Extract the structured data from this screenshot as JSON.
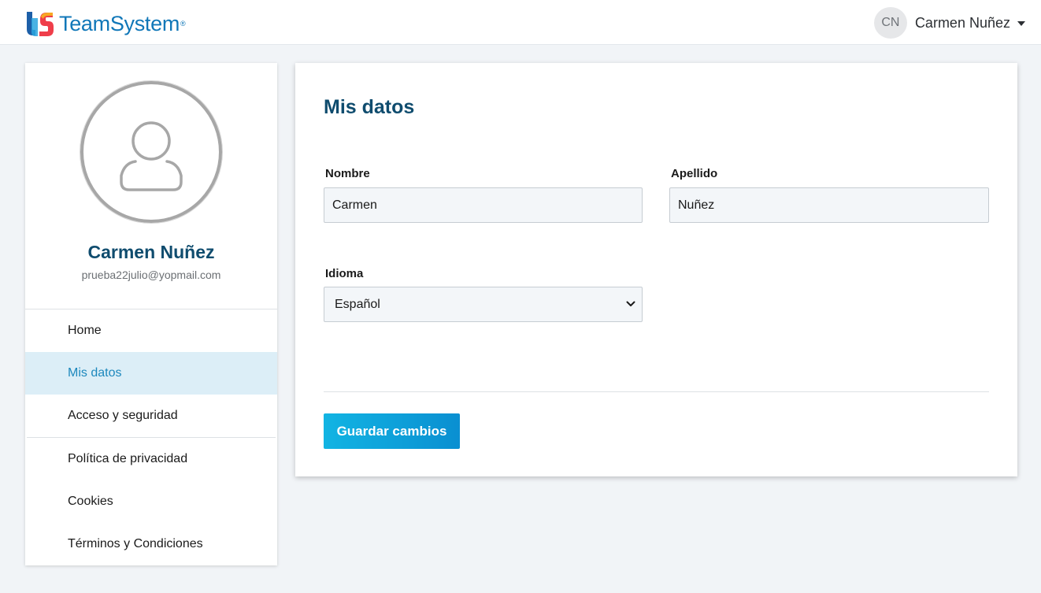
{
  "header": {
    "brand_name": "TeamSystem",
    "brand_mark": "®",
    "user_initials": "CN",
    "user_name": "Carmen Nuñez"
  },
  "profile": {
    "name": "Carmen Nuñez",
    "email": "prueba22julio@yopmail.com",
    "avatar_icon": "user-icon"
  },
  "sidebar": {
    "items": [
      {
        "label": "Home"
      },
      {
        "label": "Mis datos",
        "active": true
      },
      {
        "label": "Acceso y seguridad"
      },
      {
        "label": "Política de privacidad"
      },
      {
        "label": "Cookies"
      },
      {
        "label": "Términos y Condiciones"
      }
    ]
  },
  "form": {
    "title": "Mis datos",
    "nombre_label": "Nombre",
    "nombre_value": "Carmen",
    "apellido_label": "Apellido",
    "apellido_value": "Nuñez",
    "idioma_label": "Idioma",
    "idioma_value": "Español",
    "save_label": "Guardar cambios"
  },
  "colors": {
    "brand_blue": "#1077b8",
    "heading_navy": "#0f4c6e",
    "active_bg": "#dceef7",
    "active_text": "#1d88bd",
    "button_start": "#12b4e3",
    "button_end": "#0a8fd1"
  }
}
